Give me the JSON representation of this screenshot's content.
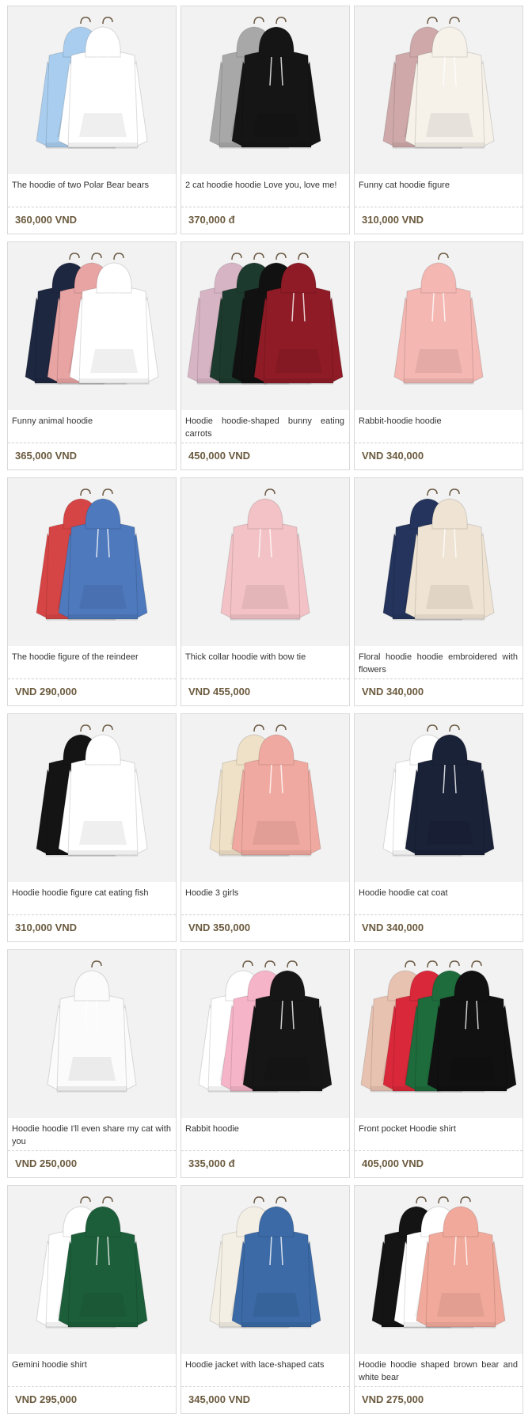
{
  "products": [
    {
      "title": "The hoodie of two Polar Bear bears",
      "price": "360,000 VND",
      "image": "hoodie-image",
      "colors": [
        "#a9cdee",
        "#ffffff"
      ]
    },
    {
      "title": "2 cat hoodie hoodie Love you, love me!",
      "price": "370,000 đ",
      "image": "hoodie-image",
      "colors": [
        "#a8a8a8",
        "#151515"
      ]
    },
    {
      "title": "Funny cat hoodie figure",
      "price": "310,000 VND",
      "image": "hoodie-image",
      "colors": [
        "#cfa9a9",
        "#f6f2ea"
      ]
    },
    {
      "title": "Funny animal hoodie",
      "price": "365,000 VND",
      "image": "hoodie-image",
      "colors": [
        "#1e2740",
        "#e8a3a3",
        "#ffffff"
      ]
    },
    {
      "title": "Hoodie hoodie-shaped bunny eating carrots",
      "price": "450,000 VND",
      "image": "hoodie-image",
      "colors": [
        "#d7b4c4",
        "#1d3a2e",
        "#111111",
        "#8e1b26"
      ]
    },
    {
      "title": "Rabbit-hoodie hoodie",
      "price": "VND 340,000",
      "image": "hoodie-image",
      "colors": [
        "#f4b7b2"
      ]
    },
    {
      "title": "The hoodie figure of the reindeer",
      "price": "VND 290,000",
      "image": "hoodie-image",
      "colors": [
        "#d64545",
        "#4e79bd"
      ]
    },
    {
      "title": "Thick collar hoodie with bow tie",
      "price": "VND 455,000",
      "image": "hoodie-image",
      "colors": [
        "#f3c2c6"
      ]
    },
    {
      "title": "Floral hoodie hoodie embroidered with flowers",
      "price": "VND 340,000",
      "image": "hoodie-image",
      "colors": [
        "#24345c",
        "#efe4d3"
      ]
    },
    {
      "title": "Hoodie hoodie figure cat eating fish",
      "price": "310,000 VND",
      "image": "hoodie-image",
      "colors": [
        "#141414",
        "#ffffff"
      ]
    },
    {
      "title": "Hoodie 3 girls",
      "price": "VND 350,000",
      "image": "hoodie-image",
      "colors": [
        "#efe0c8",
        "#f0a9a0"
      ]
    },
    {
      "title": "Hoodie hoodie cat coat",
      "price": "VND 340,000",
      "image": "hoodie-image",
      "colors": [
        "#ffffff",
        "#1a2238"
      ]
    },
    {
      "title": "Hoodie hoodie I'll even share my cat with you",
      "price": "VND 250,000",
      "image": "hoodie-image",
      "colors": [
        "#fbfbfb"
      ]
    },
    {
      "title": "Rabbit hoodie",
      "price": "335,000 đ",
      "image": "hoodie-image",
      "colors": [
        "#ffffff",
        "#f6b4c8",
        "#161616"
      ]
    },
    {
      "title": "Front pocket Hoodie shirt",
      "price": "405,000 VND",
      "image": "hoodie-image",
      "colors": [
        "#e8c2b0",
        "#d9283a",
        "#1e6b3c",
        "#111111"
      ]
    },
    {
      "title": "Gemini hoodie shirt",
      "price": "VND 295,000",
      "image": "hoodie-image",
      "colors": [
        "#ffffff",
        "#1c5e3a"
      ]
    },
    {
      "title": "Hoodie jacket with lace-shaped cats",
      "price": "345,000 VND",
      "image": "hoodie-image",
      "colors": [
        "#f4efe4",
        "#3b6aa6"
      ]
    },
    {
      "title": "Hoodie hoodie shaped brown bear and white bear",
      "price": "VND 275,000",
      "image": "hoodie-image",
      "colors": [
        "#141414",
        "#ffffff",
        "#f1a99b"
      ]
    }
  ]
}
